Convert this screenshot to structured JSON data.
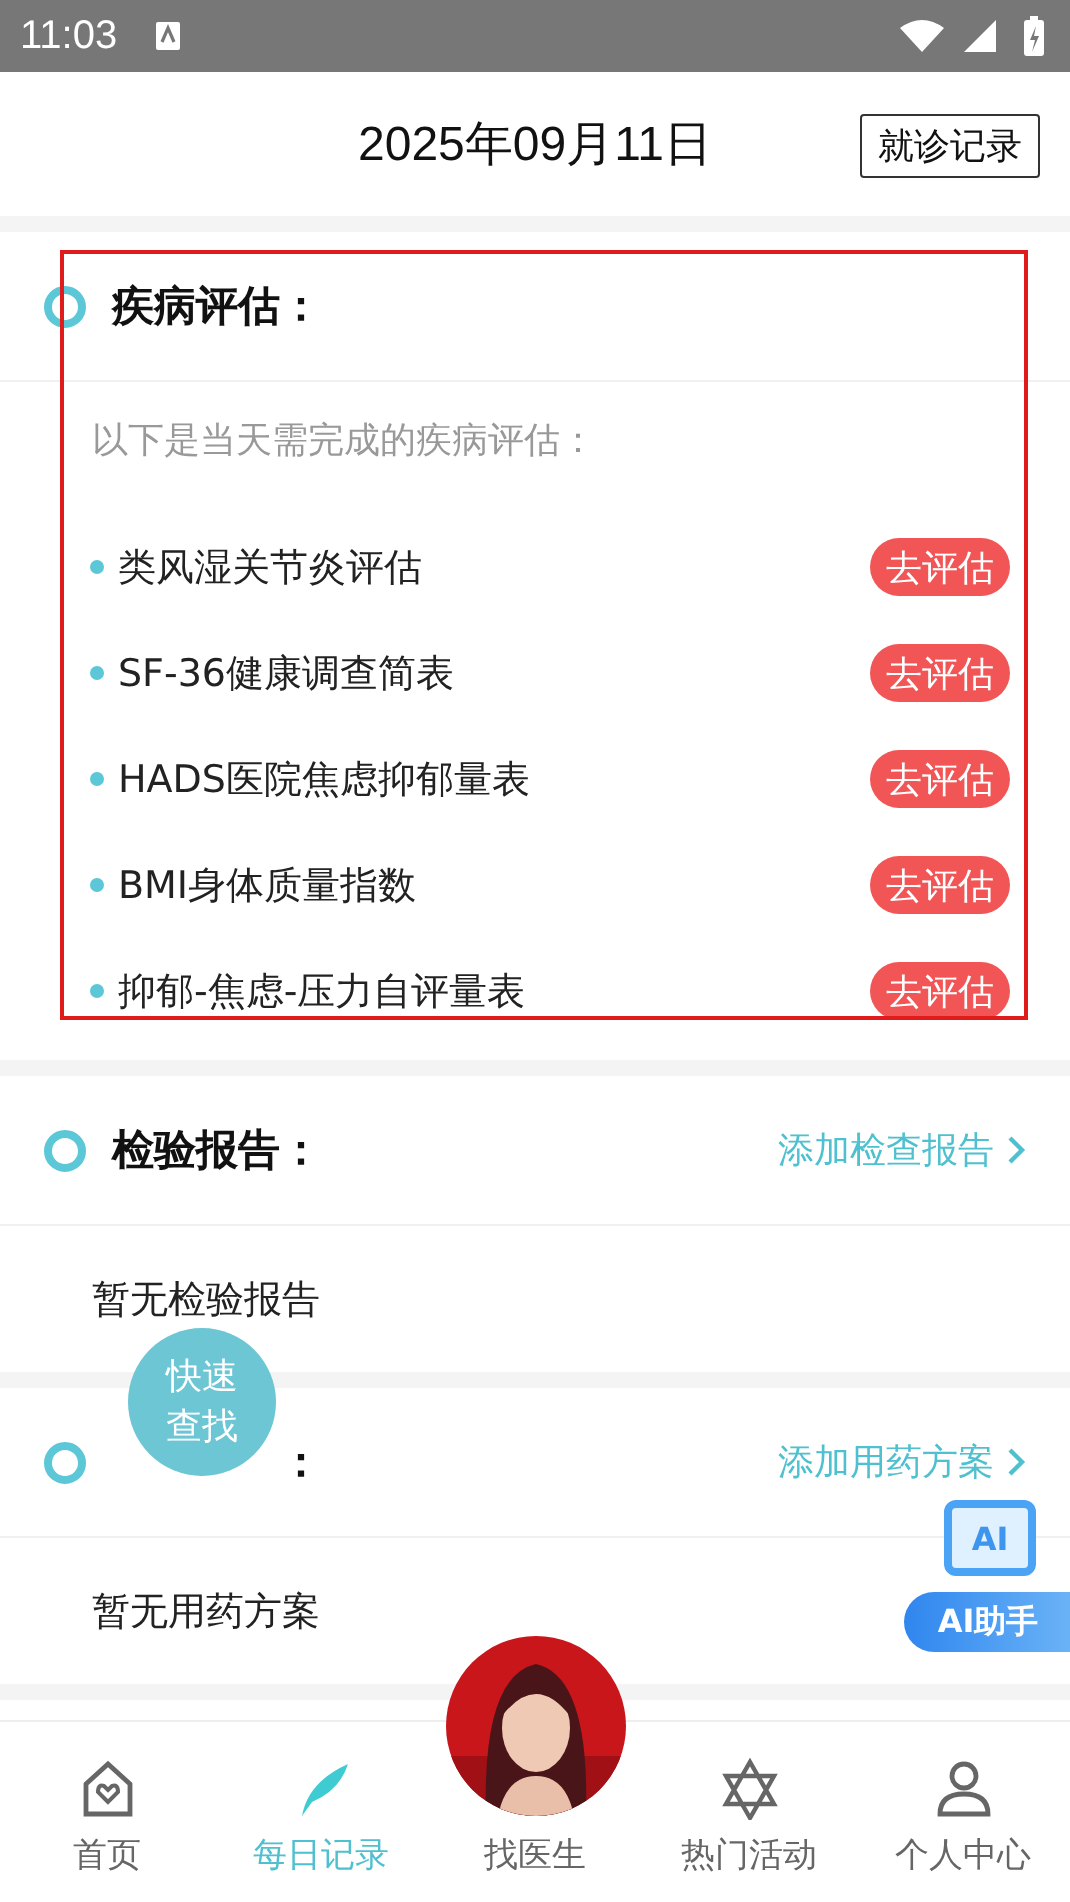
{
  "status_bar": {
    "time": "11:03"
  },
  "header": {
    "date": "2025年09月11日",
    "button": "就诊记录"
  },
  "sections": [
    {
      "kind": "list",
      "title": "疾病评估：",
      "highlighted": true,
      "intro": "以下是当天需完成的疾病评估：",
      "items": [
        {
          "name": "类风湿关节炎评估",
          "action": "去评估"
        },
        {
          "name": "SF-36健康调查简表",
          "action": "去评估"
        },
        {
          "name": "HADS医院焦虑抑郁量表",
          "action": "去评估"
        },
        {
          "name": "BMI身体质量指数",
          "action": "去评估"
        },
        {
          "name": "抑郁-焦虑-压力自评量表",
          "action": "去评估"
        }
      ]
    },
    {
      "kind": "empty",
      "title": "检验报告：",
      "link": "添加检查报告",
      "empty": "暂无检验报告"
    },
    {
      "kind": "empty",
      "title": "：",
      "covered": true,
      "link": "添加用药方案",
      "empty": "暂无用药方案"
    }
  ],
  "quick_find": "快速查找",
  "ai_assistant": {
    "icon": "AI",
    "label": "AI助手"
  },
  "nav": [
    {
      "label": "首页",
      "selected": false
    },
    {
      "label": "每日记录",
      "selected": true
    },
    {
      "label": "找医生",
      "selected": false
    },
    {
      "label": "热门活动",
      "selected": false
    },
    {
      "label": "个人中心",
      "selected": false
    }
  ]
}
